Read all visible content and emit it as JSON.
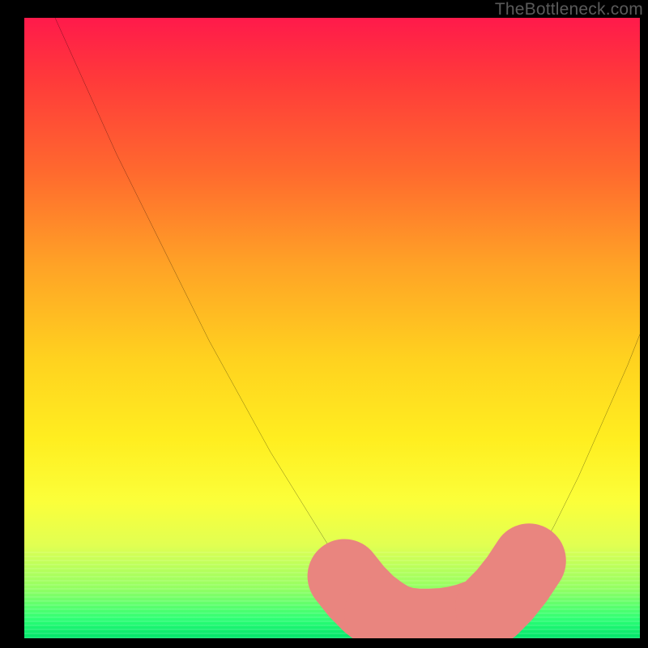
{
  "watermark": "TheBottleneck.com",
  "chart_data": {
    "type": "line",
    "title": "",
    "xlabel": "",
    "ylabel": "",
    "xlim": [
      0,
      100
    ],
    "ylim": [
      0,
      100
    ],
    "grid": false,
    "series": [
      {
        "name": "curve",
        "x": [
          5,
          10,
          15,
          20,
          25,
          30,
          35,
          40,
          45,
          50,
          54,
          58,
          62,
          66,
          70,
          74,
          78,
          82,
          86,
          90,
          94,
          98,
          100
        ],
        "y": [
          100,
          89,
          78,
          68,
          58,
          48,
          39,
          30,
          22,
          14,
          8,
          4,
          2,
          2,
          2,
          3,
          6,
          11,
          18,
          26,
          35,
          44,
          49
        ]
      }
    ],
    "highlight_segments": [
      {
        "name": "left-arm",
        "x": [
          52,
          54,
          56,
          58
        ],
        "y": [
          10,
          7.5,
          5.5,
          4
        ]
      },
      {
        "name": "valley",
        "x": [
          58,
          60,
          62,
          64,
          66,
          68,
          70,
          72,
          74
        ],
        "y": [
          4,
          2.8,
          2.2,
          2,
          2,
          2.1,
          2.4,
          2.9,
          3.6
        ]
      },
      {
        "name": "right-arm",
        "x": [
          76,
          78,
          80,
          82
        ],
        "y": [
          5,
          7,
          9.5,
          12.5
        ]
      }
    ],
    "colors": {
      "curve_stroke": "#000000",
      "highlight_stroke": "#e9857f",
      "background_top": "#ff1a4b",
      "background_bottom": "#00e56a"
    }
  }
}
